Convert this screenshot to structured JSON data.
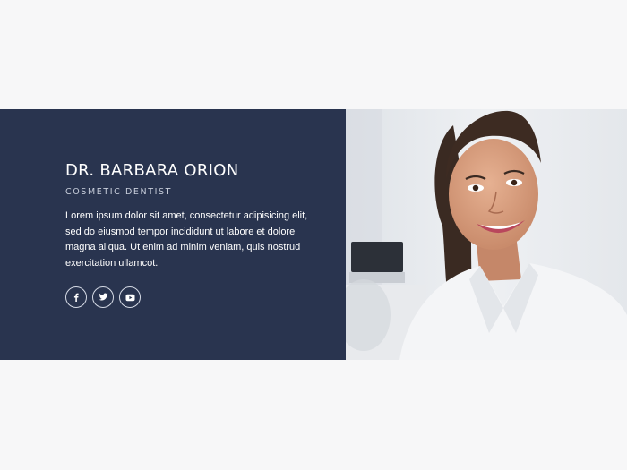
{
  "profile": {
    "name": "DR. BARBARA ORION",
    "role": "COSMETIC DENTIST",
    "bio": "Lorem ipsum dolor sit amet, consectetur adipisicing elit, sed do eiusmod tempor incididunt ut labore et dolore magna aliqua. Ut enim ad minim veniam, quis nostrud exercitation ullamcot."
  },
  "socials": [
    {
      "network": "facebook",
      "icon": "facebook-icon"
    },
    {
      "network": "twitter",
      "icon": "twitter-icon"
    },
    {
      "network": "youtube",
      "icon": "youtube-icon"
    }
  ],
  "colors": {
    "panel_background": "#29344f",
    "page_background": "#f7f7f8",
    "text_primary": "#ffffff",
    "text_secondary": "#c9cfdc"
  }
}
